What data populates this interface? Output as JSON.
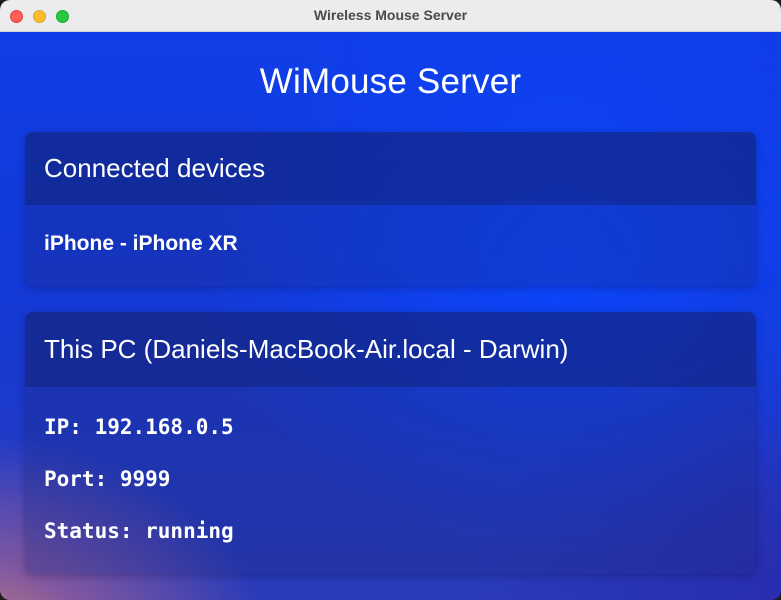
{
  "window": {
    "title": "Wireless Mouse Server"
  },
  "app": {
    "title": "WiMouse Server"
  },
  "connected_devices": {
    "header": "Connected devices",
    "items": [
      "iPhone - iPhone XR"
    ]
  },
  "this_pc": {
    "header": "This PC (Daniels-MacBook-Air.local - Darwin)",
    "ip_line": "IP: 192.168.0.5",
    "port_line": "Port: 9999",
    "status_line": "Status: running"
  },
  "colors": {
    "close": "#fe5f57",
    "minimize": "#febc2e",
    "maximize": "#28c840",
    "accent_blue": "#0f3ee8"
  }
}
